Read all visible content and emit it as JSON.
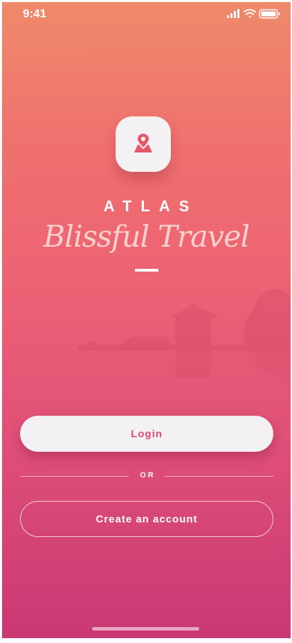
{
  "status_bar": {
    "time": "9:41",
    "icons": [
      "signal-icon",
      "wifi-icon",
      "battery-icon"
    ]
  },
  "app_icon": {
    "icon": "map-pin-icon",
    "color": "#e85669"
  },
  "brand": {
    "name": "ATLAS",
    "tagline": "Blissful Travel"
  },
  "actions": {
    "login_label": "Login",
    "separator_label": "OR",
    "create_account_label": "Create an account"
  },
  "colors": {
    "gradient_top": "#ef8a6a",
    "gradient_bottom": "#c93874",
    "accent": "#dd4a75",
    "button_background": "#f3f1f3"
  }
}
